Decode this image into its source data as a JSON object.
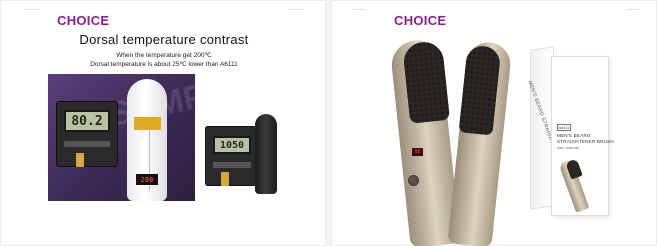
{
  "left_card": {
    "brand": "CHOICE",
    "headline": "Dorsal temperature contrast",
    "subline_1": "When the temperature get 200℃",
    "subline_2": "Dorsal temperature is about 25℃ lower than A6111",
    "meter_a_reading": "80.2",
    "meter_b_reading": "1050",
    "brush_display_reading": "200",
    "watermark": "SAMPLE"
  },
  "right_card": {
    "brand": "CHOICE",
    "box_side_text": "MEN'S BEARD STRAIGHTENER",
    "box_logo": "A6111",
    "box_title_1": "MEN'S BEARD",
    "box_title_2": "STRAIGHTENER BRUSH",
    "box_title_3": "user manual",
    "brush_display_reading": "88"
  },
  "colors": {
    "brand": "#8a1f8f",
    "gold": "#c9bfa9",
    "probe": "#e0a928"
  }
}
